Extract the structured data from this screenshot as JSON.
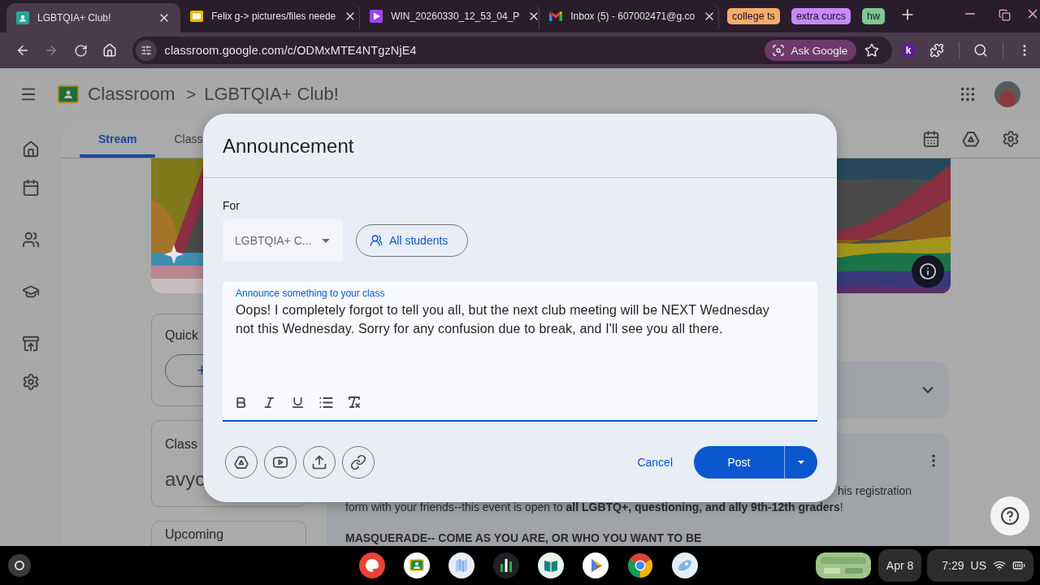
{
  "browser": {
    "tabs": [
      {
        "title": "LGBTQIA+ Club!",
        "kind": "classroom",
        "selected": true
      },
      {
        "title": "Felix g-> pictures/files neede",
        "kind": "slides",
        "selected": false
      },
      {
        "title": "WIN_20260330_12_53_04_P",
        "kind": "video",
        "selected": false
      },
      {
        "title": "Inbox (5) - 607002471@g.co",
        "kind": "mail",
        "selected": false
      }
    ],
    "tab_groups": [
      {
        "label": "college ts",
        "color": "#f6ad6b"
      },
      {
        "label": "extra curcs",
        "color": "#c58af9"
      },
      {
        "label": "hw",
        "color": "#7dc893"
      }
    ],
    "address": "classroom.google.com/c/ODMxMTE4NTgzNjE4",
    "ask_google": "Ask Google",
    "extension_badge": "k"
  },
  "classroom": {
    "app_name": "Classroom",
    "separator": ">",
    "class_name": "LGBTQIA+ Club!",
    "tabs": [
      {
        "label": "Stream",
        "selected": true
      },
      {
        "label": "Class",
        "selected": false
      }
    ],
    "quick_card": {
      "title": "Quick",
      "button": "+"
    },
    "code_card": {
      "title": "Class",
      "code": "avyc"
    },
    "upcoming_card": {
      "title": "Upcoming"
    },
    "post": {
      "lines": [
        "his registration",
        "form with your friends--this event is open to **all LGBTQ+, questioning, and ally 9th-12th graders**!",
        "MASQUERADE-- COME AS YOU ARE, OR WHO YOU WANT TO BE"
      ]
    }
  },
  "dialog": {
    "title": "Announcement",
    "for_label": "For",
    "class_select": "LGBTQIA+ C...",
    "audience": "All students",
    "editor": {
      "label": "Announce something to your class",
      "text": "Oops! I completely forgot to tell you all, but the next club meeting will be NEXT Wednesday not this Wednesday. Sorry for any confusion due to break, and I'll see you all there."
    },
    "cancel": "Cancel",
    "post": "Post"
  },
  "taskbar": {
    "date": "Apr 8",
    "time": "7:29",
    "locale": "US"
  }
}
